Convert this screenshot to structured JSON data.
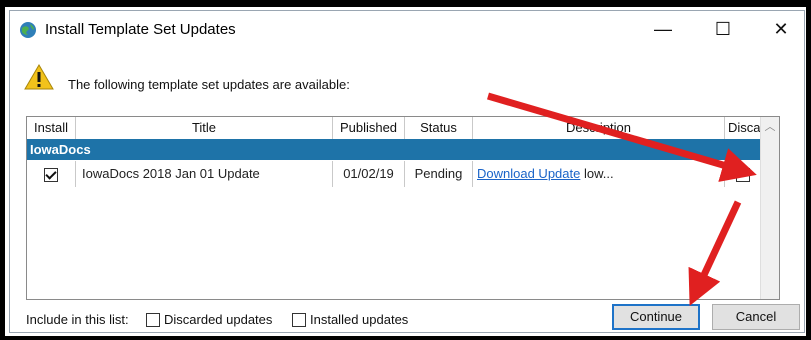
{
  "window": {
    "title": "Install Template Set Updates",
    "controls": {
      "minimize": "—",
      "maximize": "☐",
      "close": "✕"
    }
  },
  "info": {
    "message": "The following template set updates are available:"
  },
  "table": {
    "columns": [
      "Install",
      "Title",
      "Published",
      "Status",
      "Description",
      "Discard"
    ],
    "group": "IowaDocs",
    "rows": [
      {
        "install_checked": true,
        "title": "IowaDocs 2018 Jan 01 Update",
        "published": "01/02/19",
        "status": "Pending",
        "description_link": "Download Update",
        "description_rest": " low...",
        "discard_checked": false
      }
    ]
  },
  "footer": {
    "include_label": "Include in this list:",
    "discarded_label": "Discarded updates",
    "installed_label": "Installed updates",
    "continue_label": "Continue",
    "cancel_label": "Cancel"
  },
  "colors": {
    "group_bg": "#1e73a8",
    "arrow": "#e02020",
    "link": "#1a64c8"
  }
}
